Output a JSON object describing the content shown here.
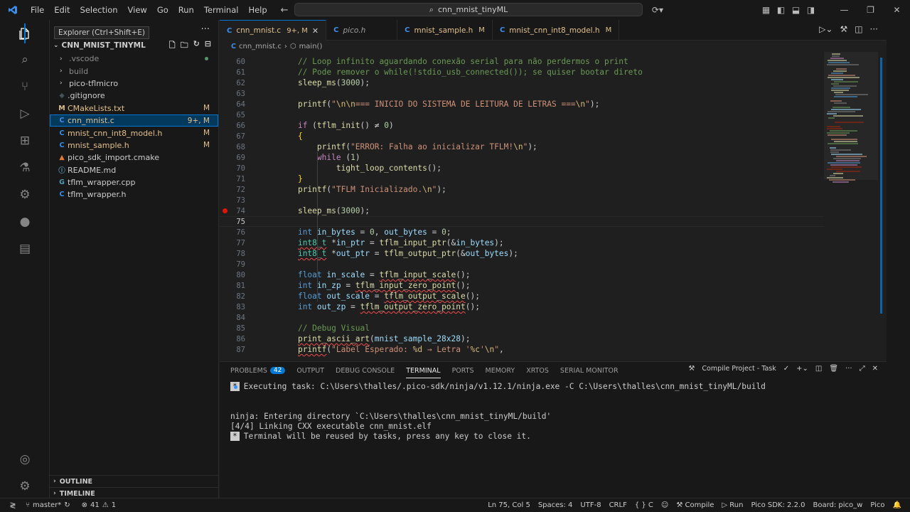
{
  "menu": [
    "File",
    "Edit",
    "Selection",
    "View",
    "Go",
    "Run",
    "Terminal",
    "Help"
  ],
  "command_center": {
    "text": "cnn_mnist_tinyML",
    "icon": "search-icon"
  },
  "tooltip": "Explorer (Ctrl+Shift+E)",
  "explorer": {
    "root": "CNN_MNIST_TINYML",
    "items": [
      {
        "name": ".vscode",
        "type": "folder",
        "color": "gray",
        "badge": "",
        "dot": true
      },
      {
        "name": "build",
        "type": "folder",
        "color": "gray",
        "badge": ""
      },
      {
        "name": "pico-tflmicro",
        "type": "folder",
        "color": "normal",
        "badge": ""
      },
      {
        "name": ".gitignore",
        "type": "git",
        "icon": "◆",
        "color": "normal",
        "badge": ""
      },
      {
        "name": "CMakeLists.txt",
        "type": "file",
        "icon": "M",
        "color": "mod",
        "badge": "M"
      },
      {
        "name": "cnn_mnist.c",
        "type": "file",
        "icon": "C",
        "color": "mod",
        "badge": "9+, M",
        "selected": true
      },
      {
        "name": "mnist_cnn_int8_model.h",
        "type": "file",
        "icon": "C",
        "color": "mod",
        "badge": "M"
      },
      {
        "name": "mnist_sample.h",
        "type": "file",
        "icon": "C",
        "color": "mod",
        "badge": "M"
      },
      {
        "name": "pico_sdk_import.cmake",
        "type": "file",
        "icon": "▲",
        "color": "normal",
        "badge": ""
      },
      {
        "name": "README.md",
        "type": "file",
        "icon": "ⓘ",
        "color": "normal",
        "badge": ""
      },
      {
        "name": "tflm_wrapper.cpp",
        "type": "file",
        "icon": "G",
        "color": "normal",
        "badge": ""
      },
      {
        "name": "tflm_wrapper.h",
        "type": "file",
        "icon": "C",
        "color": "normal",
        "badge": ""
      }
    ],
    "outline": "OUTLINE",
    "timeline": "TIMELINE"
  },
  "tabs": [
    {
      "label": "cnn_mnist.c",
      "icon": "C",
      "status": "9+, M",
      "active": true
    },
    {
      "label": "pico.h",
      "icon": "C",
      "status": ""
    },
    {
      "label": "mnist_sample.h",
      "icon": "C",
      "status": "M"
    },
    {
      "label": "mnist_cnn_int8_model.h",
      "icon": "C",
      "status": "M"
    }
  ],
  "breadcrumb": [
    "cnn_mnist.c",
    "main()"
  ],
  "breadcrumb_sep": "›",
  "editor": {
    "line_numbers": [
      "60",
      "61",
      "62",
      "63",
      "64",
      "65",
      "66",
      "67",
      "68",
      "69",
      "70",
      "71",
      "72",
      "73",
      "74",
      "75",
      "76",
      "77",
      "78",
      "79",
      "80",
      "81",
      "82",
      "83",
      "84",
      "85",
      "86",
      "87"
    ],
    "current_line": "75",
    "breakpoint_line": "74",
    "lines": [
      [
        [
          "    // Loop infinito aguardando conexão serial para não perdermos o print",
          "cm"
        ]
      ],
      [
        [
          "    // Pode remover o while(!stdio_usb_connected()); se quiser bootar direto",
          "cm"
        ]
      ],
      [
        [
          "    ",
          ""
        ],
        [
          "sleep_ms",
          "fn"
        ],
        [
          "(",
          ""
        ],
        [
          "3000",
          "num"
        ],
        [
          ");",
          ""
        ]
      ],
      [
        [
          "",
          ""
        ]
      ],
      [
        [
          "    ",
          ""
        ],
        [
          "printf",
          "fn"
        ],
        [
          "(",
          ""
        ],
        [
          "\"",
          "st"
        ],
        [
          "\\n\\n",
          "esc"
        ],
        [
          "=== INICIO DO SISTEMA DE LEITURA DE LETRAS ===",
          "st"
        ],
        [
          "\\n",
          "esc"
        ],
        [
          "\"",
          "st"
        ],
        [
          ");",
          ""
        ]
      ],
      [
        [
          "",
          ""
        ]
      ],
      [
        [
          "    ",
          ""
        ],
        [
          "if",
          "ctl"
        ],
        [
          " (",
          ""
        ],
        [
          "tflm_init",
          "fn"
        ],
        [
          "() ≠ ",
          ""
        ],
        [
          "0",
          "num"
        ],
        [
          ")",
          ""
        ]
      ],
      [
        [
          "    ",
          ""
        ],
        [
          "{",
          "br"
        ]
      ],
      [
        [
          "        ",
          ""
        ],
        [
          "printf",
          "fn"
        ],
        [
          "(",
          ""
        ],
        [
          "\"ERROR: Falha ao inicializar TFLM!",
          "st"
        ],
        [
          "\\n",
          "esc"
        ],
        [
          "\"",
          "st"
        ],
        [
          ");",
          ""
        ]
      ],
      [
        [
          "        ",
          ""
        ],
        [
          "while",
          "ctl"
        ],
        [
          " (",
          ""
        ],
        [
          "1",
          "num"
        ],
        [
          ")",
          ""
        ]
      ],
      [
        [
          "            ",
          ""
        ],
        [
          "tight_loop_contents",
          "fn"
        ],
        [
          "();",
          ""
        ]
      ],
      [
        [
          "    ",
          ""
        ],
        [
          "}",
          "br"
        ]
      ],
      [
        [
          "    ",
          ""
        ],
        [
          "printf",
          "fn"
        ],
        [
          "(",
          ""
        ],
        [
          "\"TFLM Inicializado.",
          "st"
        ],
        [
          "\\n",
          "esc"
        ],
        [
          "\"",
          "st"
        ],
        [
          ");",
          ""
        ]
      ],
      [
        [
          "",
          ""
        ]
      ],
      [
        [
          "    ",
          ""
        ],
        [
          "sleep_ms",
          "fn"
        ],
        [
          "(",
          ""
        ],
        [
          "3000",
          "num"
        ],
        [
          ");",
          ""
        ]
      ],
      [
        [
          "",
          ""
        ]
      ],
      [
        [
          "    ",
          ""
        ],
        [
          "int",
          "kw"
        ],
        [
          " ",
          ""
        ],
        [
          "in_bytes",
          "var"
        ],
        [
          " = ",
          ""
        ],
        [
          "0",
          "num"
        ],
        [
          ", ",
          ""
        ],
        [
          "out_bytes",
          "var"
        ],
        [
          " = ",
          ""
        ],
        [
          "0",
          "num"
        ],
        [
          ";",
          ""
        ]
      ],
      [
        [
          "    ",
          ""
        ],
        [
          "int8_t",
          "ty sq"
        ],
        [
          " *",
          ""
        ],
        [
          "in_ptr",
          "var"
        ],
        [
          " = ",
          ""
        ],
        [
          "tflm_input_ptr",
          "fn"
        ],
        [
          "(&",
          ""
        ],
        [
          "in_bytes",
          "var"
        ],
        [
          ");",
          ""
        ]
      ],
      [
        [
          "    ",
          ""
        ],
        [
          "int8_t",
          "ty sq"
        ],
        [
          " *",
          ""
        ],
        [
          "out_ptr",
          "var"
        ],
        [
          " = ",
          ""
        ],
        [
          "tflm_output_ptr",
          "fn"
        ],
        [
          "(&",
          ""
        ],
        [
          "out_bytes",
          "var"
        ],
        [
          ");",
          ""
        ]
      ],
      [
        [
          "",
          ""
        ]
      ],
      [
        [
          "    ",
          ""
        ],
        [
          "float",
          "kw"
        ],
        [
          " ",
          ""
        ],
        [
          "in_scale",
          "var"
        ],
        [
          " = ",
          ""
        ],
        [
          "tflm_input_scale",
          "fn sq"
        ],
        [
          "();",
          ""
        ]
      ],
      [
        [
          "    ",
          ""
        ],
        [
          "int",
          "kw"
        ],
        [
          " ",
          ""
        ],
        [
          "in_zp",
          "var"
        ],
        [
          " = ",
          ""
        ],
        [
          "tflm_input_zero_point",
          "fn sq"
        ],
        [
          "();",
          ""
        ]
      ],
      [
        [
          "    ",
          ""
        ],
        [
          "float",
          "kw"
        ],
        [
          " ",
          ""
        ],
        [
          "out_scale",
          "var"
        ],
        [
          " = ",
          ""
        ],
        [
          "tflm_output_scale",
          "fn sq"
        ],
        [
          "();",
          ""
        ]
      ],
      [
        [
          "    ",
          ""
        ],
        [
          "int",
          "kw"
        ],
        [
          " ",
          ""
        ],
        [
          "out_zp",
          "var"
        ],
        [
          " = ",
          ""
        ],
        [
          "tflm_output_zero_point",
          "fn sq"
        ],
        [
          "();",
          ""
        ]
      ],
      [
        [
          "",
          ""
        ]
      ],
      [
        [
          "    ",
          ""
        ],
        [
          "// Debug Visual",
          "cm"
        ]
      ],
      [
        [
          "    ",
          ""
        ],
        [
          "print_ascii_art",
          "fn sq"
        ],
        [
          "(",
          ""
        ],
        [
          "mnist_sample_28x28",
          "var"
        ],
        [
          ");",
          ""
        ]
      ],
      [
        [
          "    ",
          ""
        ],
        [
          "printf",
          "fn sq"
        ],
        [
          "(",
          ""
        ],
        [
          "\"Label Esperado: ",
          "st"
        ],
        [
          "%d",
          "esc"
        ],
        [
          " → Letra '",
          "st"
        ],
        [
          "%c",
          "esc"
        ],
        [
          "'",
          "st"
        ],
        [
          "\\n",
          "esc"
        ],
        [
          "\"",
          "st"
        ],
        [
          ",",
          ""
        ]
      ]
    ]
  },
  "panel": {
    "tabs": [
      {
        "label": "PROBLEMS",
        "count": "42"
      },
      {
        "label": "OUTPUT"
      },
      {
        "label": "DEBUG CONSOLE"
      },
      {
        "label": "TERMINAL",
        "active": true
      },
      {
        "label": "PORTS"
      },
      {
        "label": "MEMORY"
      },
      {
        "label": "XRTOS"
      },
      {
        "label": "SERIAL MONITOR"
      }
    ],
    "task_name": "Compile Project - Task",
    "terminal": [
      {
        "star": true,
        "text": "Executing task: C:\\Users\\thalles/.pico-sdk/ninja/v1.12.1/ninja.exe -C C:\\Users\\thalles\\cnn_mnist_tinyML/build"
      },
      {
        "star": false,
        "text": ""
      },
      {
        "star": false,
        "text": "ninja: Entering directory `C:\\Users\\thalles\\cnn_mnist_tinyML/build'"
      },
      {
        "star": false,
        "text": "[4/4] Linking CXX executable cnn_mnist.elf"
      },
      {
        "star": true,
        "text": "Terminal will be reused by tasks, press any key to close it."
      }
    ]
  },
  "status": {
    "branch": "master*",
    "errors": "41",
    "warnings": "1",
    "position": "Ln 75, Col 5",
    "spaces": "Spaces: 4",
    "encoding": "UTF-8",
    "eol": "CRLF",
    "language": "C",
    "compile": "Compile",
    "run": "Run",
    "sdk": "Pico SDK: 2.2.0",
    "board": "Board: pico_w",
    "pico": "Pico"
  },
  "colors": {
    "accent": "#0078d4",
    "modified": "#e2c08d",
    "background": "#1f1f1f",
    "chrome": "#181818"
  }
}
